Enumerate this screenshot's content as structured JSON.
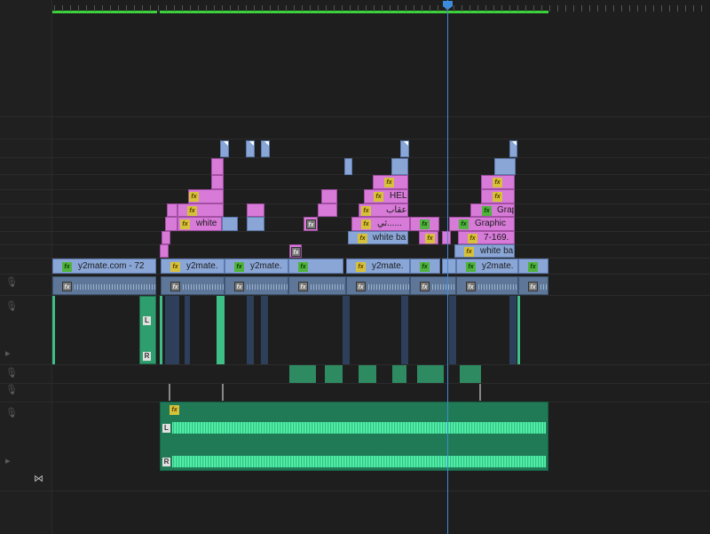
{
  "timeline": {
    "clips": {
      "v1_a": "y2mate.com  - 72",
      "v1_b": "y2mate.",
      "v1_c": "y2mate.",
      "v1_d": "y2mate.",
      "v1_e": "y2mate.",
      "white_a": "white",
      "white_b": "white ba",
      "white_c": "white ba",
      "graphic_a": "Graphic",
      "graphic_b": "Grap",
      "hel": "HEL",
      "arabic_a": "عقاب",
      "arabic_b": "ثي......",
      "num": "7-169.",
      "fx": "fx",
      "L": "L",
      "R": "R"
    }
  },
  "colors": {
    "accent_playhead": "#3d8bdb",
    "work_area": "#3bd23b",
    "video_clip": "#8aa6d6",
    "graphic_clip": "#d77ad8",
    "audio_clip": "#2f9e6e"
  },
  "icons": [
    "mic-icon",
    "play-icon",
    "bowtie-icon",
    "fx-badge-icon"
  ]
}
